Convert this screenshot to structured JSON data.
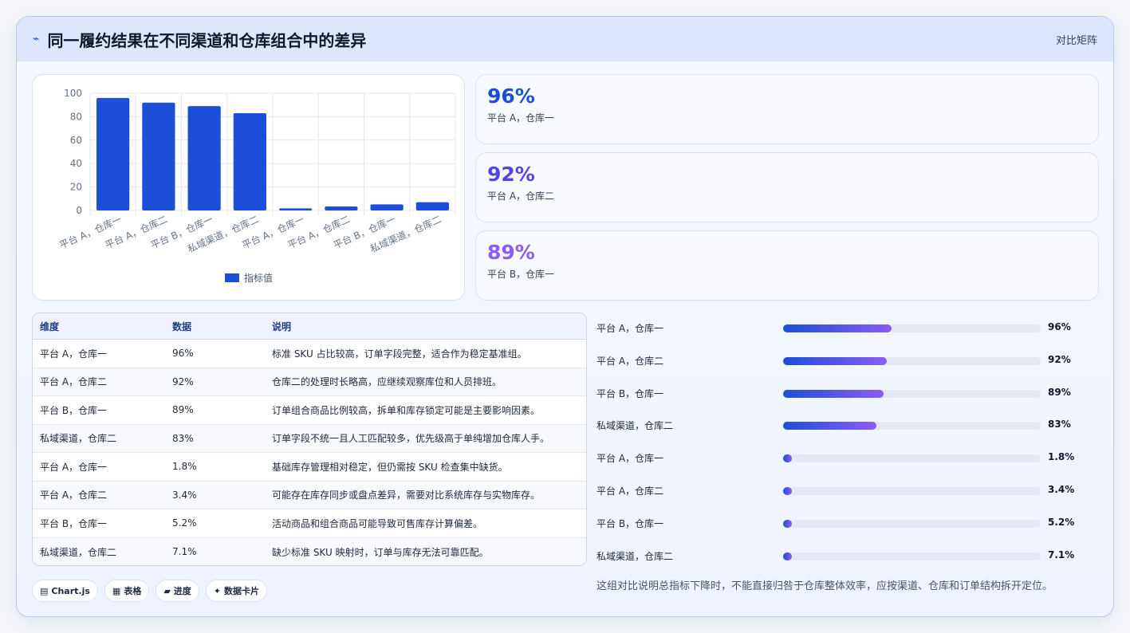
{
  "header": {
    "title": "同一履约结果在不同渠道和仓库组合中的差异",
    "mode_label": "对比矩阵"
  },
  "chart_data": {
    "type": "bar",
    "categories": [
      "平台 A，仓库一",
      "平台 A，仓库二",
      "平台 B，仓库一",
      "私域渠道，仓库二",
      "平台 A，仓库一",
      "平台 A，仓库二",
      "平台 B，仓库一",
      "私域渠道，仓库二"
    ],
    "series": [
      {
        "name": "指标值",
        "values": [
          96,
          92,
          89,
          83,
          1.8,
          3.4,
          5.2,
          7.1
        ]
      }
    ],
    "ylim": [
      0,
      100
    ],
    "yticks": [
      0,
      20,
      40,
      60,
      80,
      100
    ],
    "legend": "bottom",
    "grid": true,
    "colors": {
      "bar": "#1d4ed8"
    }
  },
  "kpis": [
    {
      "value": "96%",
      "label": "平台 A，仓库一",
      "color": "#1d4ed8"
    },
    {
      "value": "92%",
      "label": "平台 A，仓库二",
      "color": "#4f46e5"
    },
    {
      "value": "89%",
      "label": "平台 B，仓库一",
      "color": "#8b5cf6"
    }
  ],
  "table": {
    "headers": [
      "维度",
      "数据",
      "说明"
    ],
    "rows": [
      [
        "平台 A，仓库一",
        "96%",
        "标准 SKU 占比较高，订单字段完整，适合作为稳定基准组。"
      ],
      [
        "平台 A，仓库二",
        "92%",
        "仓库二的处理时长略高，应继续观察库位和人员排班。"
      ],
      [
        "平台 B，仓库一",
        "89%",
        "订单组合商品比例较高，拆单和库存锁定可能是主要影响因素。"
      ],
      [
        "私域渠道，仓库二",
        "83%",
        "订单字段不统一且人工匹配较多，优先级高于单纯增加仓库人手。"
      ],
      [
        "平台 A，仓库一",
        "1.8%",
        "基础库存管理相对稳定，但仍需按 SKU 检查集中缺货。"
      ],
      [
        "平台 A，仓库二",
        "3.4%",
        "可能存在库存同步或盘点差异，需要对比系统库存与实物库存。"
      ],
      [
        "平台 B，仓库一",
        "5.2%",
        "活动商品和组合商品可能导致可售库存计算偏差。"
      ],
      [
        "私域渠道，仓库二",
        "7.1%",
        "缺少标准 SKU 映射时，订单与库存无法可靠匹配。"
      ]
    ]
  },
  "progress": [
    {
      "label": "平台 A，仓库一",
      "value_text": "96%",
      "pct": 96
    },
    {
      "label": "平台 A，仓库二",
      "value_text": "92%",
      "pct": 92
    },
    {
      "label": "平台 B，仓库一",
      "value_text": "89%",
      "pct": 89
    },
    {
      "label": "私域渠道，仓库二",
      "value_text": "83%",
      "pct": 83
    },
    {
      "label": "平台 A，仓库一",
      "value_text": "1.8%",
      "pct": 1.8
    },
    {
      "label": "平台 A，仓库二",
      "value_text": "3.4%",
      "pct": 3.4
    },
    {
      "label": "平台 B，仓库一",
      "value_text": "5.2%",
      "pct": 5.2
    },
    {
      "label": "私域渠道，仓库二",
      "value_text": "7.1%",
      "pct": 7.1
    }
  ],
  "note": "这组对比说明总指标下降时，不能直接归咎于仓库整体效率，应按渠道、仓库和订单结构拆开定位。",
  "chips": [
    {
      "icon": "chart-icon",
      "glyph": "▤",
      "label": "Chart.js"
    },
    {
      "icon": "table-icon",
      "glyph": "▦",
      "label": "表格"
    },
    {
      "icon": "progress-icon",
      "glyph": "▰",
      "label": "进度"
    },
    {
      "icon": "card-icon",
      "glyph": "✦",
      "label": "数据卡片"
    }
  ]
}
